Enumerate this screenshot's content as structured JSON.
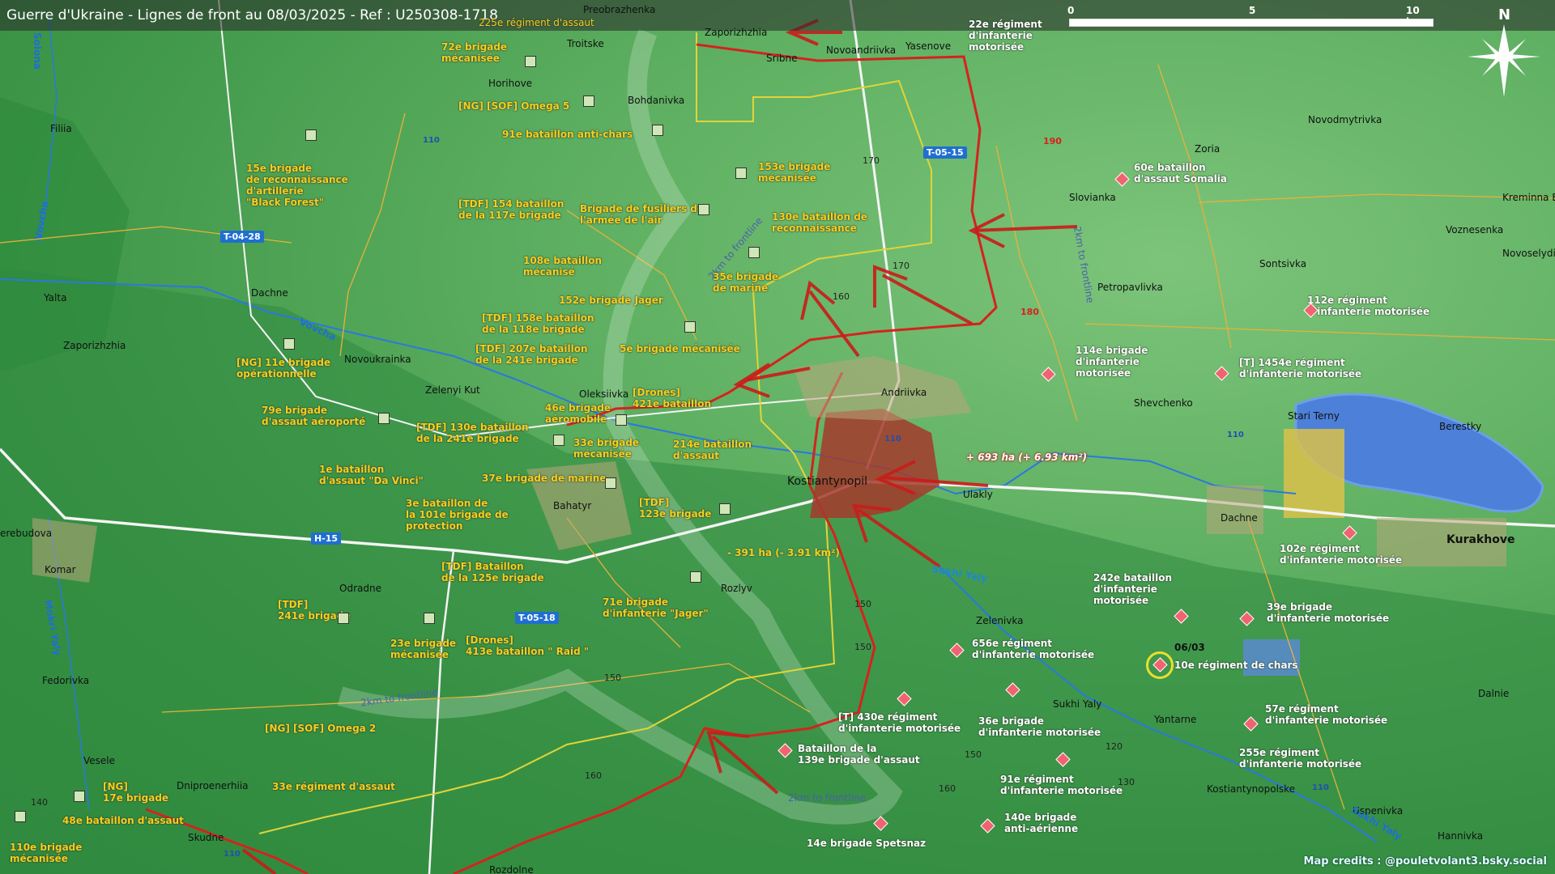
{
  "title": "Guerre d'Ukraine - Lignes de front au 08/03/2025 - Ref : U250308-1718",
  "scale": {
    "labels": [
      "0",
      "5",
      "10 km"
    ]
  },
  "north_label": "N",
  "credits": "Map credits : @pouletvolant3.bsky.social",
  "colors": {
    "ukraine_units": "#f2d21b",
    "russia_units": "#ffffff",
    "front_line": "#d4231e",
    "highway_label": "#1f6fd0",
    "captured_area": "#a43a2c"
  },
  "places": [
    {
      "name": "Preobrazhenka"
    },
    {
      "name": "Troitske"
    },
    {
      "name": "Zaporizhzhia"
    },
    {
      "name": "Sribne"
    },
    {
      "name": "Novoandriivka"
    },
    {
      "name": "Yasenove"
    },
    {
      "name": "Horihove"
    },
    {
      "name": "Bohdanivka"
    },
    {
      "name": "Filiia"
    },
    {
      "name": "Zoria"
    },
    {
      "name": "Novodmytrivka"
    },
    {
      "name": "Slovianka"
    },
    {
      "name": "Kreminna Ba"
    },
    {
      "name": "Voznesenka"
    },
    {
      "name": "Novoselydi"
    },
    {
      "name": "Sontsivka"
    },
    {
      "name": "Petropavlivka"
    },
    {
      "name": "Yalta"
    },
    {
      "name": "Dachne"
    },
    {
      "name": "Zaporizhzhia"
    },
    {
      "name": "Novoukrainka"
    },
    {
      "name": "Zelenyi Kut"
    },
    {
      "name": "Oleksiivka"
    },
    {
      "name": "Andriivka"
    },
    {
      "name": "Shevchenko"
    },
    {
      "name": "Stari Terny"
    },
    {
      "name": "Berestky"
    },
    {
      "name": "Kostiantynopil"
    },
    {
      "name": "Ulakly"
    },
    {
      "name": "Bahatyr"
    },
    {
      "name": "Dachne"
    },
    {
      "name": "Kurakhove"
    },
    {
      "name": "erebudova"
    },
    {
      "name": "Komar"
    },
    {
      "name": "Odradne"
    },
    {
      "name": "Rozlyv"
    },
    {
      "name": "Fedorivka"
    },
    {
      "name": "Zelenivka"
    },
    {
      "name": "Sukhi Yaly"
    },
    {
      "name": "Yantarne"
    },
    {
      "name": "Dalnie"
    },
    {
      "name": "Vesele"
    },
    {
      "name": "Dniproenerhiia"
    },
    {
      "name": "Skudne"
    },
    {
      "name": "Kostiantynopolske"
    },
    {
      "name": "Uspenivka"
    },
    {
      "name": "Hannivka"
    },
    {
      "name": "Rozdolne"
    }
  ],
  "rivers": [
    "Solona",
    "Vovcha",
    "Vovcha",
    "Sukhi Yaly",
    "Mokri Yaly",
    "Sukhi Yaly"
  ],
  "roads": [
    "T-05-15",
    "T-04-28",
    "H-15",
    "T-05-18"
  ],
  "road_numbers": [
    "110",
    "110",
    "110",
    "110",
    "110"
  ],
  "elevations": [
    "170",
    "170",
    "160",
    "150",
    "140",
    "150",
    "120",
    "130",
    "150",
    "160",
    "150",
    "160",
    "140",
    "110"
  ],
  "elevations_red": [
    "190",
    "180"
  ],
  "frontline_buffer_labels": [
    "2km to frontline",
    "2km to frontline",
    "2km to frontline",
    "2km to frontline"
  ],
  "territory_changes": {
    "gain": "+ 693 ha (+ 6.93 km²)",
    "loss": "- 391 ha (- 3.91 km²)"
  },
  "date_marker": "06/03",
  "ukraine_units": [
    {
      "label": "72e brigade\nmécanisée"
    },
    {
      "label": "[NG] [SOF] Omega 5"
    },
    {
      "label": "91e bataillon anti-chars"
    },
    {
      "label": "15e brigade\nde reconnaissance\nd'artillerie\n\"Black Forest\""
    },
    {
      "label": "[TDF] 154 bataillon\nde la 117e brigade"
    },
    {
      "label": "Brigade de fusiliers de\nl'armée de l'air"
    },
    {
      "label": "153e brigade\nmécanisée"
    },
    {
      "label": "130e bataillon de\nreconnaissance"
    },
    {
      "label": "108e bataillon\nmécanisé"
    },
    {
      "label": "35e brigade\nde marine"
    },
    {
      "label": "152e brigade Jager"
    },
    {
      "label": "[TDF] 158e bataillon\nde la 118e brigade"
    },
    {
      "label": "[TDF] 207e bataillon\nde la 241e brigade"
    },
    {
      "label": "5e brigade mécanisée"
    },
    {
      "label": "[NG] 11e brigade\nopérationnelle"
    },
    {
      "label": "[Drones]\n421e bataillon"
    },
    {
      "label": "46e brigade\naéromobile"
    },
    {
      "label": "79e brigade\nd'assaut aéroporté"
    },
    {
      "label": "[TDF] 130e bataillon\nde la 241e brigade"
    },
    {
      "label": "33e brigade\nmécanisée"
    },
    {
      "label": "214e bataillon\nd'assaut"
    },
    {
      "label": "1e bataillon\nd'assaut \"Da Vinci\""
    },
    {
      "label": "37e brigade de marine"
    },
    {
      "label": "3e bataillon de\nla 101e brigade de\nprotection"
    },
    {
      "label": "[TDF]\n123e brigade"
    },
    {
      "label": "[TDF] Bataillon\nde la 125e brigade"
    },
    {
      "label": "71e brigade\nd'infanterie \"Jager\""
    },
    {
      "label": "[TDF]\n241e brigade"
    },
    {
      "label": "23e brigade\nmécanisée"
    },
    {
      "label": "[Drones]\n413e bataillon \" Raid \""
    },
    {
      "label": "[NG] [SOF] Omega 2"
    },
    {
      "label": "[NG]\n17e brigade"
    },
    {
      "label": "33e régiment d'assaut"
    },
    {
      "label": "48e bataillon d'assaut"
    },
    {
      "label": "110e brigade\nmécanisée"
    },
    {
      "label": "225e régiment d'assaut"
    }
  ],
  "russia_units": [
    {
      "label": "22e régiment\nd'infanterie\nmotorisée"
    },
    {
      "label": "60e bataillon\nd'assaut Somalia"
    },
    {
      "label": "112e régiment\nd'infanterie motorisée"
    },
    {
      "label": "114e brigade\nd'infanterie\nmotorisée"
    },
    {
      "label": "[T] 1454e régiment\nd'infanterie motorisée"
    },
    {
      "label": "102e régiment\nd'infanterie motorisée"
    },
    {
      "label": "242e bataillon\nd'infanterie\nmotorisée"
    },
    {
      "label": "39e brigade\nd'infanterie motorisée"
    },
    {
      "label": "656e régiment\nd'infanterie motorisée"
    },
    {
      "label": "10e régiment de chars"
    },
    {
      "label": "[T] 430e régiment\nd'infanterie motorisée"
    },
    {
      "label": "36e brigade\nd'infanterie motorisée"
    },
    {
      "label": "57e régiment\nd'infanterie motorisée"
    },
    {
      "label": "Bataillon de la\n139e brigade d'assaut"
    },
    {
      "label": "255e régiment\nd'infanterie motorisée"
    },
    {
      "label": "91e régiment\nd'infanterie motorisée"
    },
    {
      "label": "140e brigade\nanti-aérienne"
    },
    {
      "label": "14e brigade Spetsnaz"
    }
  ]
}
